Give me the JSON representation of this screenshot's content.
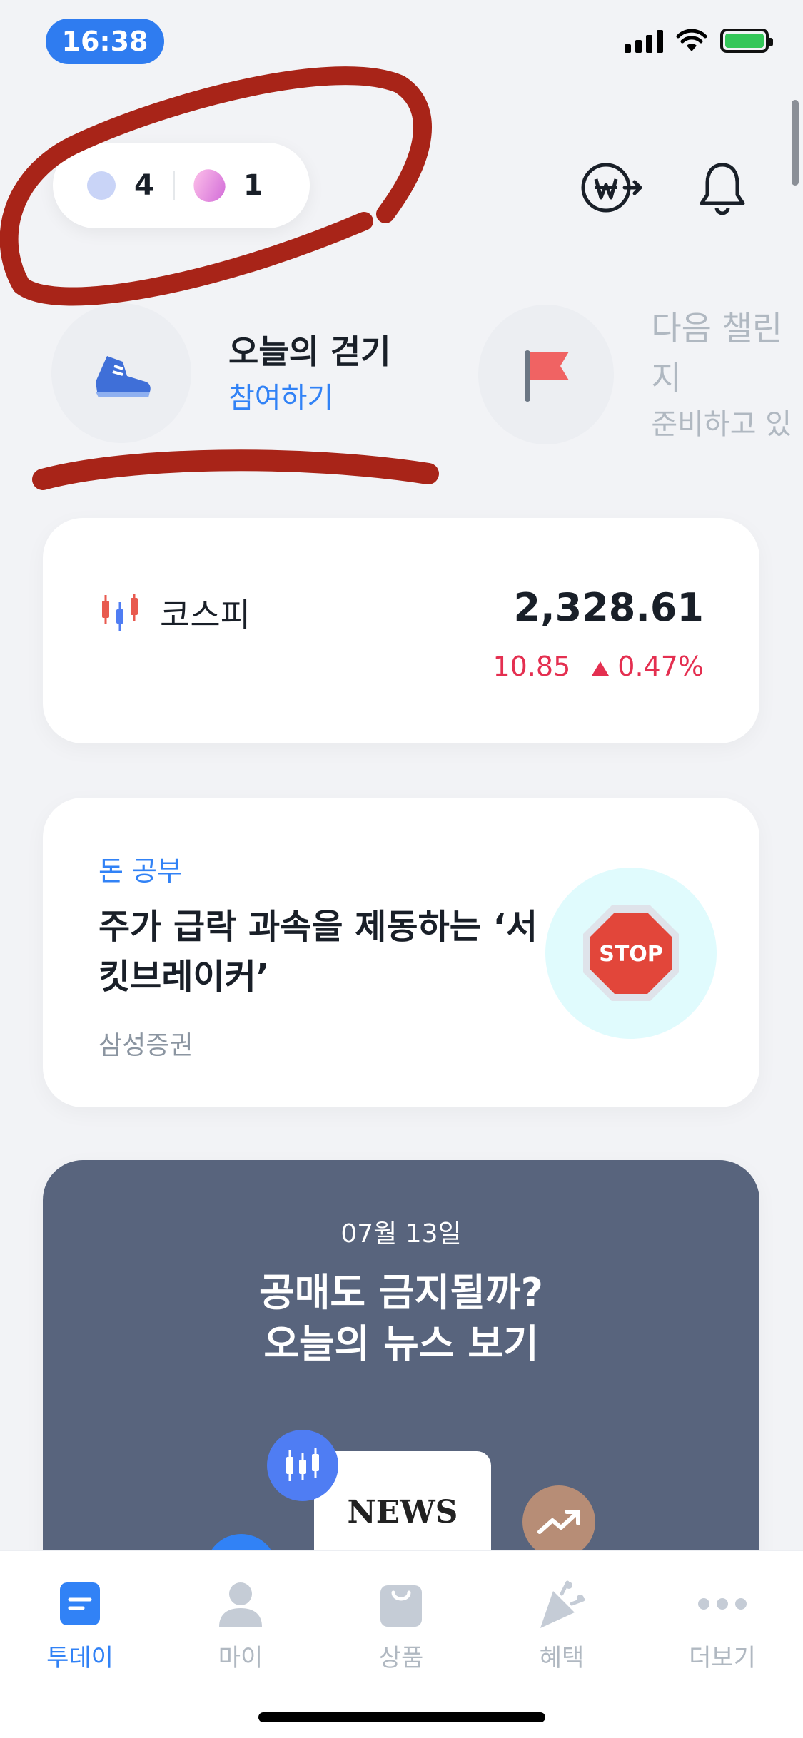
{
  "status_bar": {
    "time": "16:38"
  },
  "points": {
    "coins": "4",
    "gems": "1"
  },
  "top_actions": {
    "exchange_icon": "won-exchange-icon",
    "bell_icon": "bell-icon"
  },
  "challenges": [
    {
      "title": "오늘의 걷기",
      "action": "참여하기",
      "icon": "sneaker-icon"
    },
    {
      "title": "다음 챌린지",
      "action": "준비하고 있",
      "icon": "flag-icon"
    }
  ],
  "kospi": {
    "name": "코스피",
    "value": "2,328.61",
    "change": "10.85",
    "change_pct": "0.47%",
    "color": "#e42f50"
  },
  "study": {
    "label": "돈 공부",
    "title": "주가 급락 과속을 제동하는 ‘서킷브레이커’",
    "source": "삼성증권",
    "image_text": "STOP"
  },
  "news": {
    "date": "07월 13일",
    "title_line1": "공매도 금지될까?",
    "title_line2": "오늘의 뉴스 보기",
    "paper_text": "NEWS"
  },
  "tabs": [
    {
      "label": "투데이",
      "icon": "today-icon",
      "active": true
    },
    {
      "label": "마이",
      "icon": "person-icon",
      "active": false
    },
    {
      "label": "상품",
      "icon": "shopping-bag-icon",
      "active": false
    },
    {
      "label": "혜택",
      "icon": "party-popper-icon",
      "active": false
    },
    {
      "label": "더보기",
      "icon": "more-dots-icon",
      "active": false
    }
  ],
  "colors": {
    "accent": "#3182f6",
    "time_pill": "#2f7cf0",
    "news_bg": "#58647d",
    "annotation": "#a82418"
  }
}
